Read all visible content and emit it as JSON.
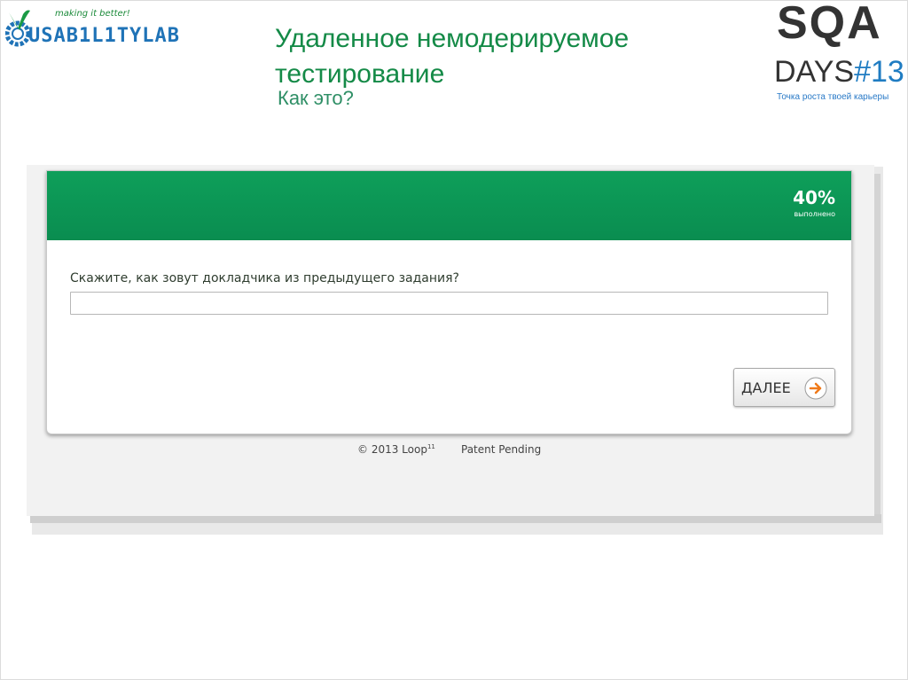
{
  "header": {
    "logo_left": {
      "tagline": "making it better!",
      "wordmark": "USAB1L1TYLAB"
    },
    "title": "Удаленное немодерируемое тестирование",
    "subtitle": "Как это?",
    "logo_right": {
      "line1": "SQA",
      "days": "DAYS",
      "hash_number": "#13",
      "caption": "Точка роста твоей карьеры"
    }
  },
  "survey": {
    "progress": {
      "value_text": "40%",
      "label": "выполнено",
      "percent": 40
    },
    "question": "Скажите, как зовут докладчика из предыдущего задания?",
    "answer": {
      "value": "",
      "placeholder": ""
    },
    "next_button_label": "ДАЛЕЕ",
    "footer": {
      "copyright": "© 2013 Loop",
      "copyright_sup": "11",
      "patent": "Patent Pending"
    }
  },
  "colors": {
    "title_green": "#148a47",
    "header_green": "#0e9f5a",
    "arrow_orange": "#f07a1a",
    "logo_blue": "#1f73b7"
  }
}
